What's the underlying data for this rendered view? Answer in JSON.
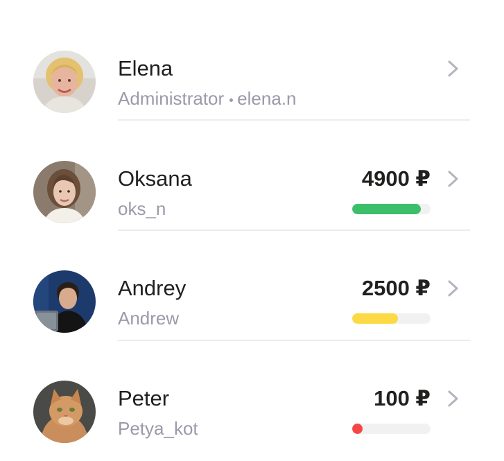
{
  "users": [
    {
      "name": "Elena",
      "role": "Administrator",
      "login": "elena.n",
      "avatar": "woman-blonde-avatar"
    },
    {
      "name": "Oksana",
      "login": "oks_n",
      "amount": "4900 ₽",
      "limit_fraction": 0.88,
      "bar_color": "#3bbf6b",
      "avatar": "woman-brown-hair-avatar"
    },
    {
      "name": "Andrey",
      "login": "Andrew",
      "amount": "2500 ₽",
      "limit_fraction": 0.58,
      "bar_color": "#fcd945",
      "avatar": "man-laptop-avatar"
    },
    {
      "name": "Peter",
      "login": "Petya_kot",
      "amount": "100 ₽",
      "limit_fraction": 0.02,
      "bar_color": "#f54646",
      "avatar": "cat-avatar"
    }
  ],
  "icons": {
    "row_chevron": "chevron-right-icon"
  },
  "colors": {
    "text_primary": "#21201f",
    "text_secondary": "#9b9aaa",
    "bar_track": "#f1f1f1",
    "divider": "#ececef"
  }
}
